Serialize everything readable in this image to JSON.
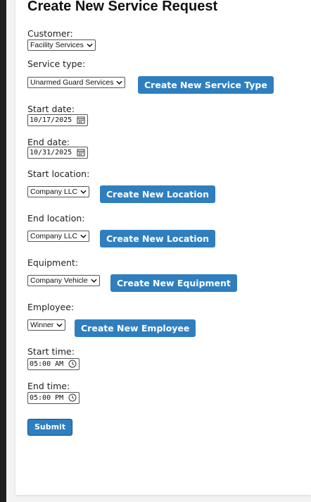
{
  "page": {
    "title": "Create New Service Request"
  },
  "form": {
    "customer": {
      "label": "Customer:",
      "selected": "Facility Services"
    },
    "service_type": {
      "label": "Service type:",
      "selected": "Unarmed Guard Services",
      "button": "Create New Service Type"
    },
    "start_date": {
      "label": "Start date:",
      "value": "10/17/2025"
    },
    "end_date": {
      "label": "End date:",
      "value": "10/31/2025"
    },
    "start_location": {
      "label": "Start location:",
      "selected": "Company LLC",
      "button": "Create New Location"
    },
    "end_location": {
      "label": "End location:",
      "selected": "Company LLC",
      "button": "Create New Location"
    },
    "equipment": {
      "label": "Equipment:",
      "selected": "Company Vehicle",
      "button": "Create New Equipment"
    },
    "employee": {
      "label": "Employee:",
      "selected": "Winner",
      "button": "Create New Employee"
    },
    "start_time": {
      "label": "Start time:",
      "value": "05:00 AM"
    },
    "end_time": {
      "label": "End time:",
      "value": "05:00 PM"
    },
    "submit": "Submit"
  },
  "icons": {
    "select": "chevron-down-icon",
    "date": "calendar-icon",
    "time": "clock-icon"
  },
  "colors": {
    "button": "#2f7fbf",
    "submit_border": "#1b4f7a",
    "background_dark": "#1f1f1f",
    "page": "#f3f3f3",
    "card": "#ffffff"
  }
}
